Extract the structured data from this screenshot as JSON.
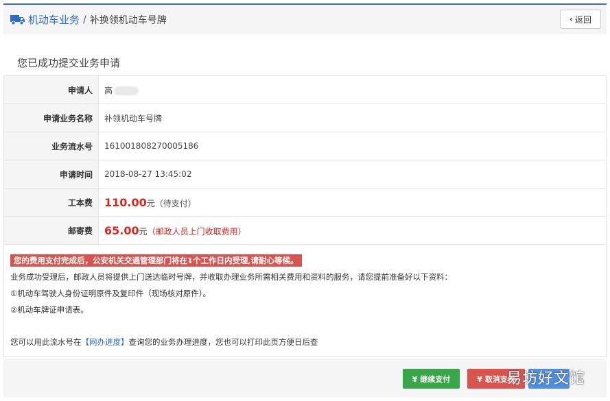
{
  "header": {
    "breadcrumb_main": "机动车业务",
    "breadcrumb_sep": "/",
    "breadcrumb_sub": "补换领机动车号牌",
    "back_label": "返回",
    "accent": "#3a6db5"
  },
  "success_title": "您已成功提交业务申请",
  "table": {
    "applicant_label": "申请人",
    "applicant_value": "高",
    "business_label": "申请业务名称",
    "business_value": "补领机动车号牌",
    "serial_label": "业务流水号",
    "serial_value": "161001808270005186",
    "time_label": "申请时间",
    "time_value": "2018-08-27 13:45:02",
    "fee_label": "工本费",
    "fee_value": "110.00",
    "fee_unit": "元",
    "fee_note": "（待支付）",
    "postage_label": "邮寄费",
    "postage_value": "65.00",
    "postage_unit": "元",
    "postage_note": "（邮政人员上门收取费用）"
  },
  "notice": {
    "alert": "您的费用支付完成后，公安机关交通管理部门将在1个工作日内受理,请耐心等候。",
    "line1": "业务成功受理后，邮政人员将提供上门送达临时号牌，并收取办理业务所需相关费用和资料的服务，请您提前准备好以下资料：",
    "line2": "①机动车驾驶人身份证明原件及复印件（现场核对原件）。",
    "line3": "②机动车牌证申请表。",
    "line4_pre": "您可以用此流水号在",
    "line4_link": "【网办进度】",
    "line4_post": "查询您的业务办理进度，您也可以打印此页方便日后查"
  },
  "footer": {
    "pay_label": "¥ 继续支付",
    "cancel_label": "¥ 取消支付",
    "watermark": "易坊好文馆"
  },
  "colors": {
    "price_red": "#d7261e",
    "pay_green": "#3aa64a",
    "cancel_red": "#d9534f",
    "link_blue": "#2a6cc4"
  }
}
